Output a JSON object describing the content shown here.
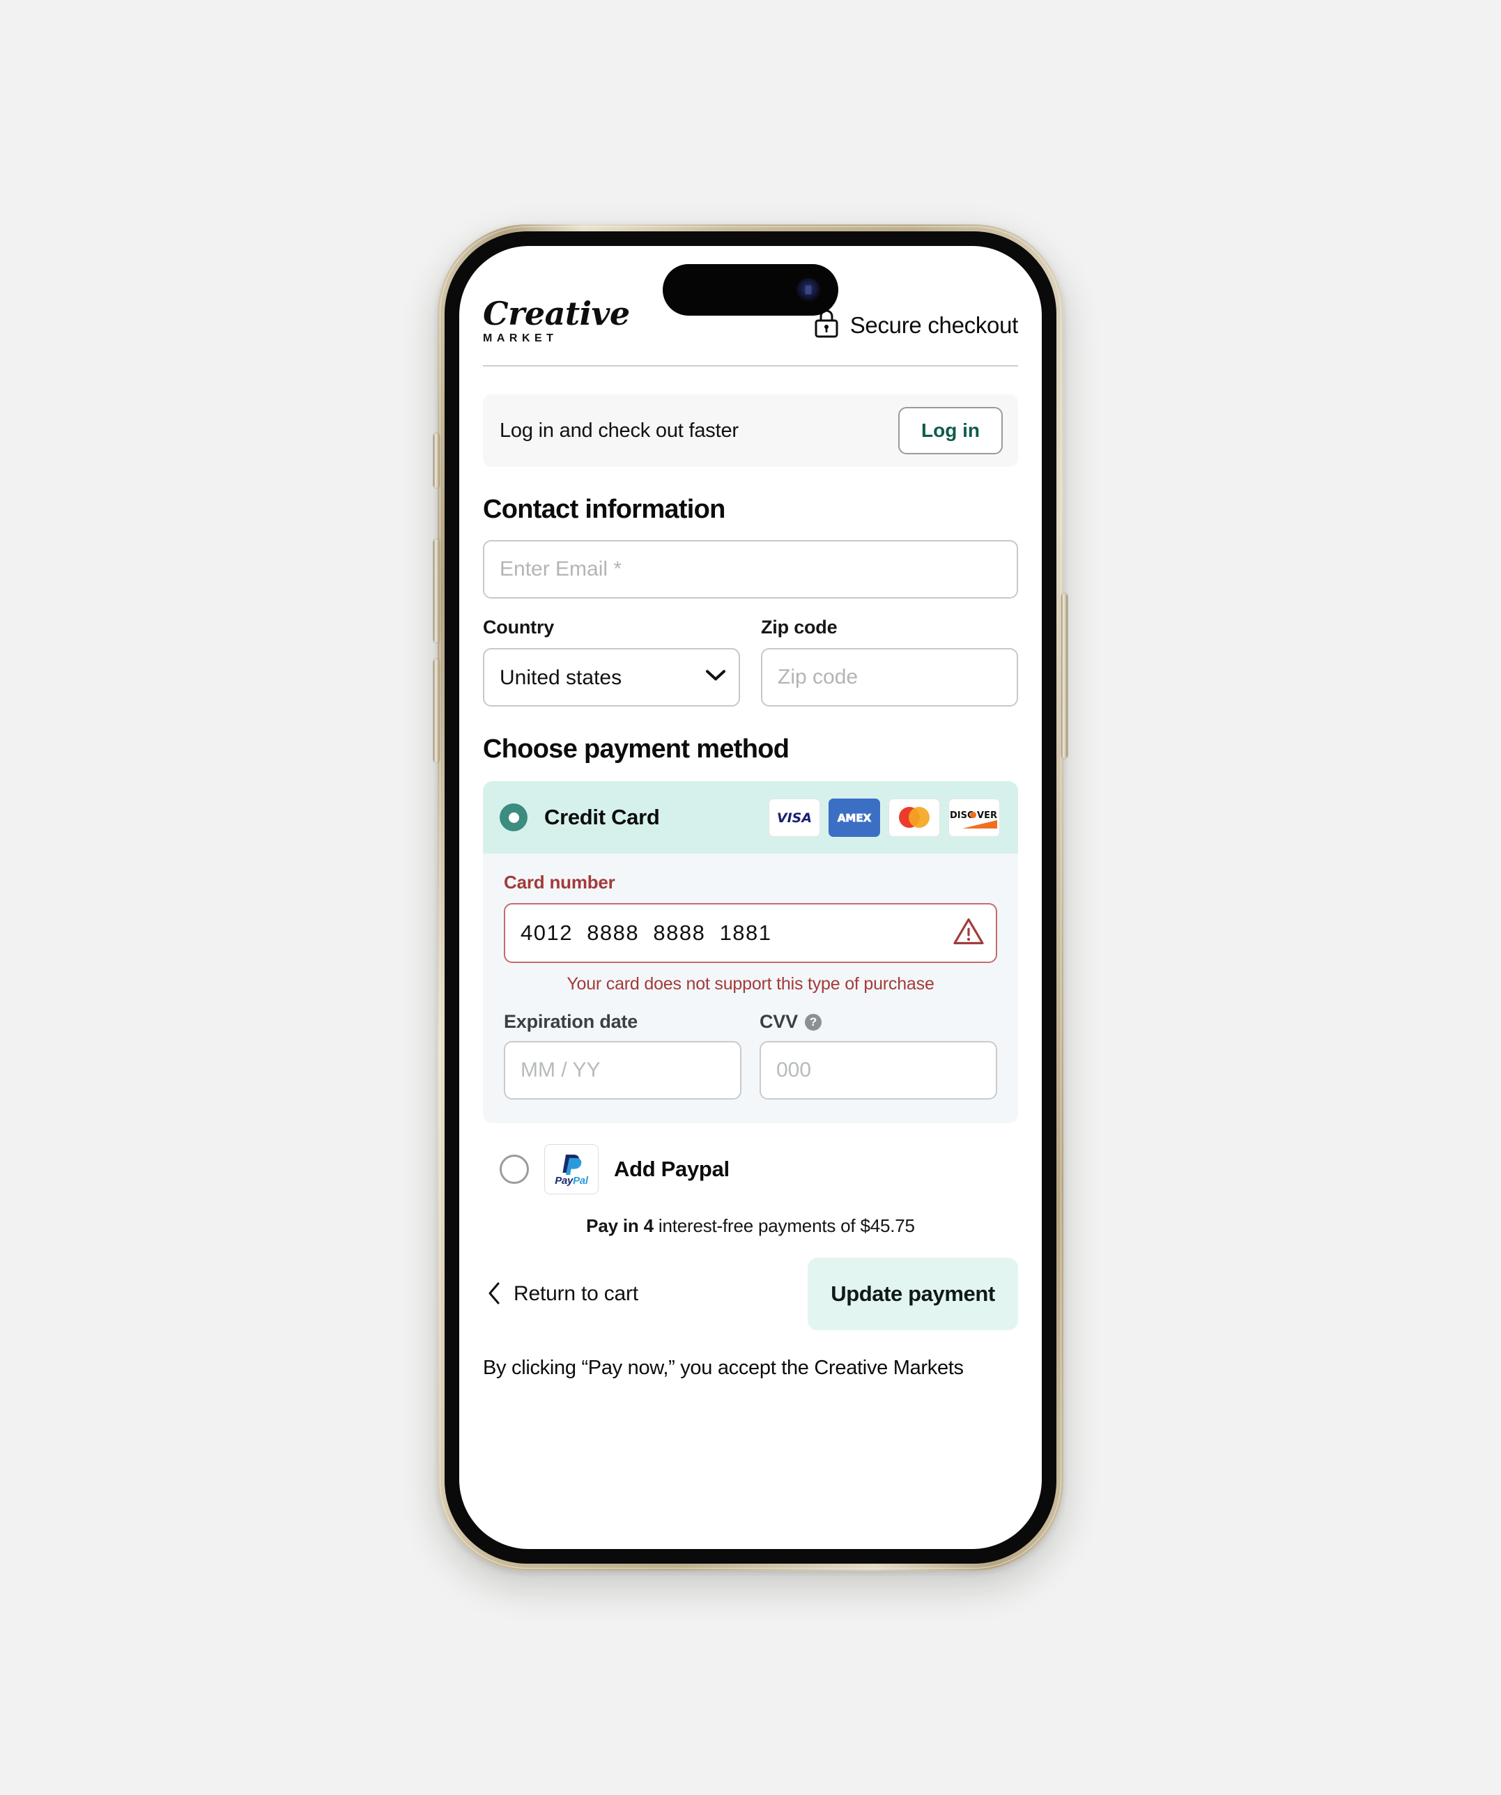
{
  "header": {
    "brand_name": "Creative",
    "brand_sub": "MARKET",
    "secure_text": "Secure checkout",
    "lock_icon": "lock-icon"
  },
  "login_banner": {
    "text": "Log in and check out faster",
    "button_label": "Log in"
  },
  "contact": {
    "title": "Contact information",
    "email_placeholder": "Enter Email *",
    "email_value": "",
    "country_label": "Country",
    "country_value": "United states",
    "country_options": [
      "United states"
    ],
    "zip_label": "Zip code",
    "zip_placeholder": "Zip code",
    "zip_value": ""
  },
  "payment": {
    "title": "Choose payment method",
    "credit_card": {
      "label": "Credit Card",
      "selected": true,
      "radio_icon": "radio-selected-icon",
      "brands": [
        "VISA",
        "AMEX",
        "Mastercard",
        "DISCOVER"
      ],
      "card_number_label": "Card number",
      "card_number_value": "4012  8888  8888  1881",
      "card_number_error": "Your card does not support this type of purchase",
      "warning_icon": "warning-triangle-icon",
      "expiration_label": "Expiration date",
      "expiration_placeholder": "MM / YY",
      "expiration_value": "",
      "cvv_label": "CVV",
      "cvv_help_icon": "help-circle-icon",
      "cvv_placeholder": "000",
      "cvv_value": ""
    },
    "paypal": {
      "label": "Add Paypal",
      "selected": false,
      "radio_icon": "radio-unselected-icon",
      "logo_top": "Pay",
      "logo_bottom": "Pal"
    },
    "pay_in_4_bold": "Pay in 4",
    "pay_in_4_rest": " interest-free payments of $45.75"
  },
  "footer": {
    "return_label": "Return to cart",
    "back_icon": "chevron-left-icon",
    "update_label": "Update payment",
    "legal_text": "By clicking “Pay now,” you accept the Creative Markets"
  },
  "colors": {
    "accent_teal": "#3c8c80",
    "mint_selected": "#d6f1ec",
    "mint_button": "#e2f5f1",
    "error_red": "#a33a3a",
    "login_green": "#0f5c4c",
    "panel_bg": "#f3f7f9"
  }
}
